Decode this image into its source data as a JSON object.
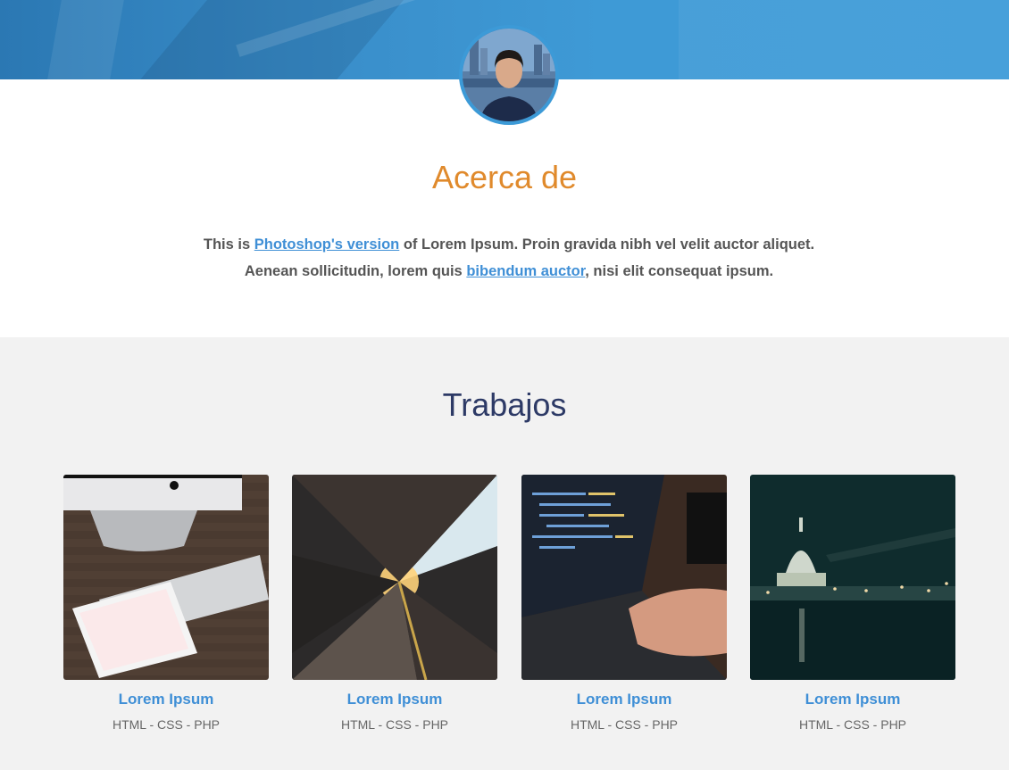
{
  "about": {
    "title": "Acerca de",
    "text_1": "This is ",
    "link_1": "Photoshop's version",
    "text_2": " of Lorem Ipsum. Proin gravida nibh vel velit auctor aliquet. Aenean sollicitudin, lorem quis ",
    "link_2": "bibendum auctor",
    "text_3": ", nisi elit consequat ipsum."
  },
  "works": {
    "title": "Trabajos",
    "items": [
      {
        "title": "Lorem Ipsum",
        "tags": "HTML - CSS - PHP",
        "image": "desk-imac-keyboard-ipad"
      },
      {
        "title": "Lorem Ipsum",
        "tags": "HTML - CSS - PHP",
        "image": "train-platform-sunset"
      },
      {
        "title": "Lorem Ipsum",
        "tags": "HTML - CSS - PHP",
        "image": "laptop-code-typing"
      },
      {
        "title": "Lorem Ipsum",
        "tags": "HTML - CSS - PHP",
        "image": "city-night-cathedral"
      }
    ]
  },
  "colors": {
    "accent_orange": "#e08a2c",
    "link_blue": "#3f8fd6",
    "title_navy": "#2d3a66",
    "hero_blue": "#3c9bd8"
  }
}
